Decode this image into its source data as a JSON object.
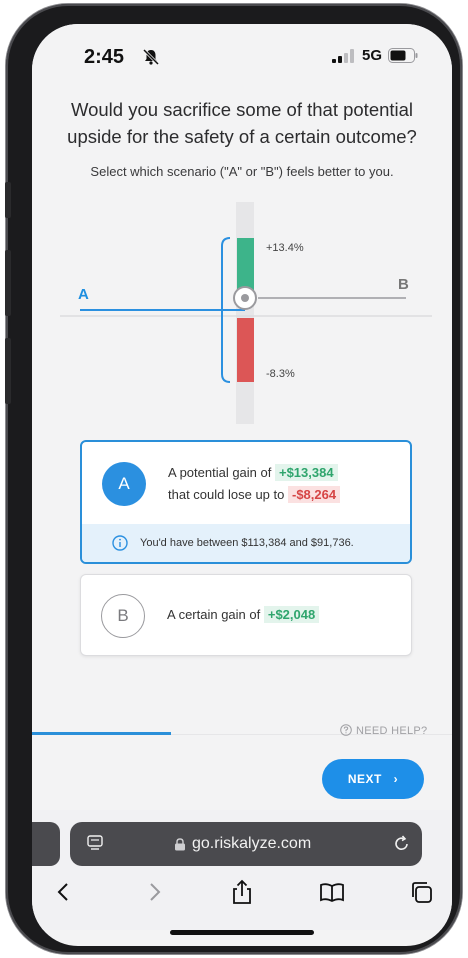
{
  "status_bar": {
    "time": "2:45",
    "network": "5G",
    "icons": [
      "bell-slash-icon",
      "signal-icon",
      "battery-icon"
    ]
  },
  "question": "Would you sacrifice some of that potential upside for the safety of a certain outcome?",
  "instruction": "Select which scenario (\"A\" or \"B\") feels better to you.",
  "chart": {
    "upper_pct": "+13.4%",
    "lower_pct": "-8.3%",
    "label_a": "A",
    "label_b": "B",
    "colors": {
      "gain": "#3db48a",
      "loss": "#dc5656",
      "accent": "#2b90e0"
    }
  },
  "option_a": {
    "badge": "A",
    "text_1": "A potential gain of",
    "gain": "+$13,384",
    "text_2": "that could lose up to",
    "loss": "-$8,264",
    "info": "You'd have between $113,384 and $91,736."
  },
  "option_b": {
    "badge": "B",
    "text": "A certain gain of",
    "gain": "+$2,048"
  },
  "progress": {
    "fraction": 0.33
  },
  "help_label": "NEED HELP?",
  "next_button": "NEXT",
  "safari": {
    "url": "go.riskalyze.com",
    "toolbar_icons": [
      "back-icon",
      "forward-icon",
      "share-icon",
      "bookmarks-icon",
      "tabs-icon"
    ]
  }
}
